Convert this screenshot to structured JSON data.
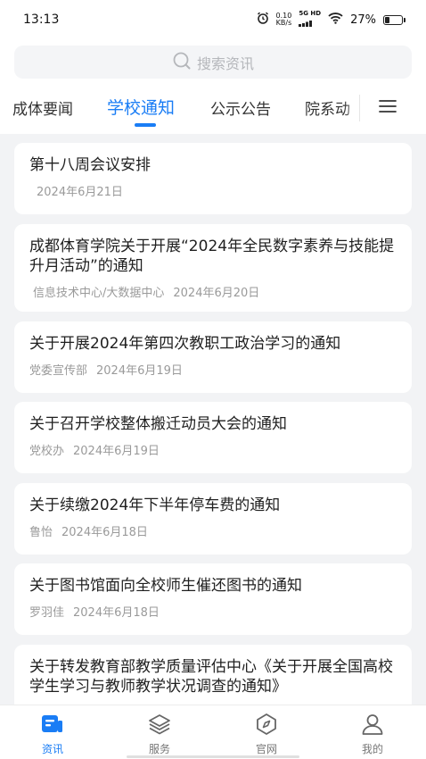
{
  "status": {
    "time": "13:13",
    "net_speed_top": "0.10",
    "net_speed_bottom": "KB/s",
    "signal_label": "5G HD",
    "battery": "27%",
    "battery_level": 0.27
  },
  "search": {
    "placeholder": "搜索资讯",
    "icon": "search-icon"
  },
  "tabs": [
    {
      "label": "成体要闻"
    },
    {
      "label": "学校通知",
      "active": true
    },
    {
      "label": "公示公告"
    },
    {
      "label": "院系动"
    }
  ],
  "menu_icon": "menu-icon",
  "news": [
    {
      "title": "第十八周会议安排",
      "source": "",
      "date": "2024年6月21日"
    },
    {
      "title": "成都体育学院关于开展“2024年全民数字素养与技能提升月活动”的通知",
      "source": "信息技术中心/大数据中心",
      "date": "2024年6月20日"
    },
    {
      "title": "关于开展2024年第四次教职工政治学习的通知",
      "source": "党委宣传部",
      "date": "2024年6月19日"
    },
    {
      "title": "关于召开学校整体搬迁动员大会的通知",
      "source": "党校办",
      "date": "2024年6月19日"
    },
    {
      "title": "关于续缴2024年下半年停车费的通知",
      "source": "鲁怡",
      "date": "2024年6月18日"
    },
    {
      "title": "关于图书馆面向全校师生催还图书的通知",
      "source": "罗羽佳",
      "date": "2024年6月18日"
    },
    {
      "title": "关于转发教育部教学质量评估中心《关于开展全国高校学生学习与教师教学状况调查的通知》",
      "source": "",
      "date": ""
    }
  ],
  "nav": [
    {
      "label": "资讯",
      "icon": "news-icon",
      "active": true
    },
    {
      "label": "服务",
      "icon": "layers-icon"
    },
    {
      "label": "官网",
      "icon": "compass-icon"
    },
    {
      "label": "我的",
      "icon": "user-icon"
    }
  ],
  "colors": {
    "accent": "#1a7df5",
    "background": "#f2f3f5"
  }
}
